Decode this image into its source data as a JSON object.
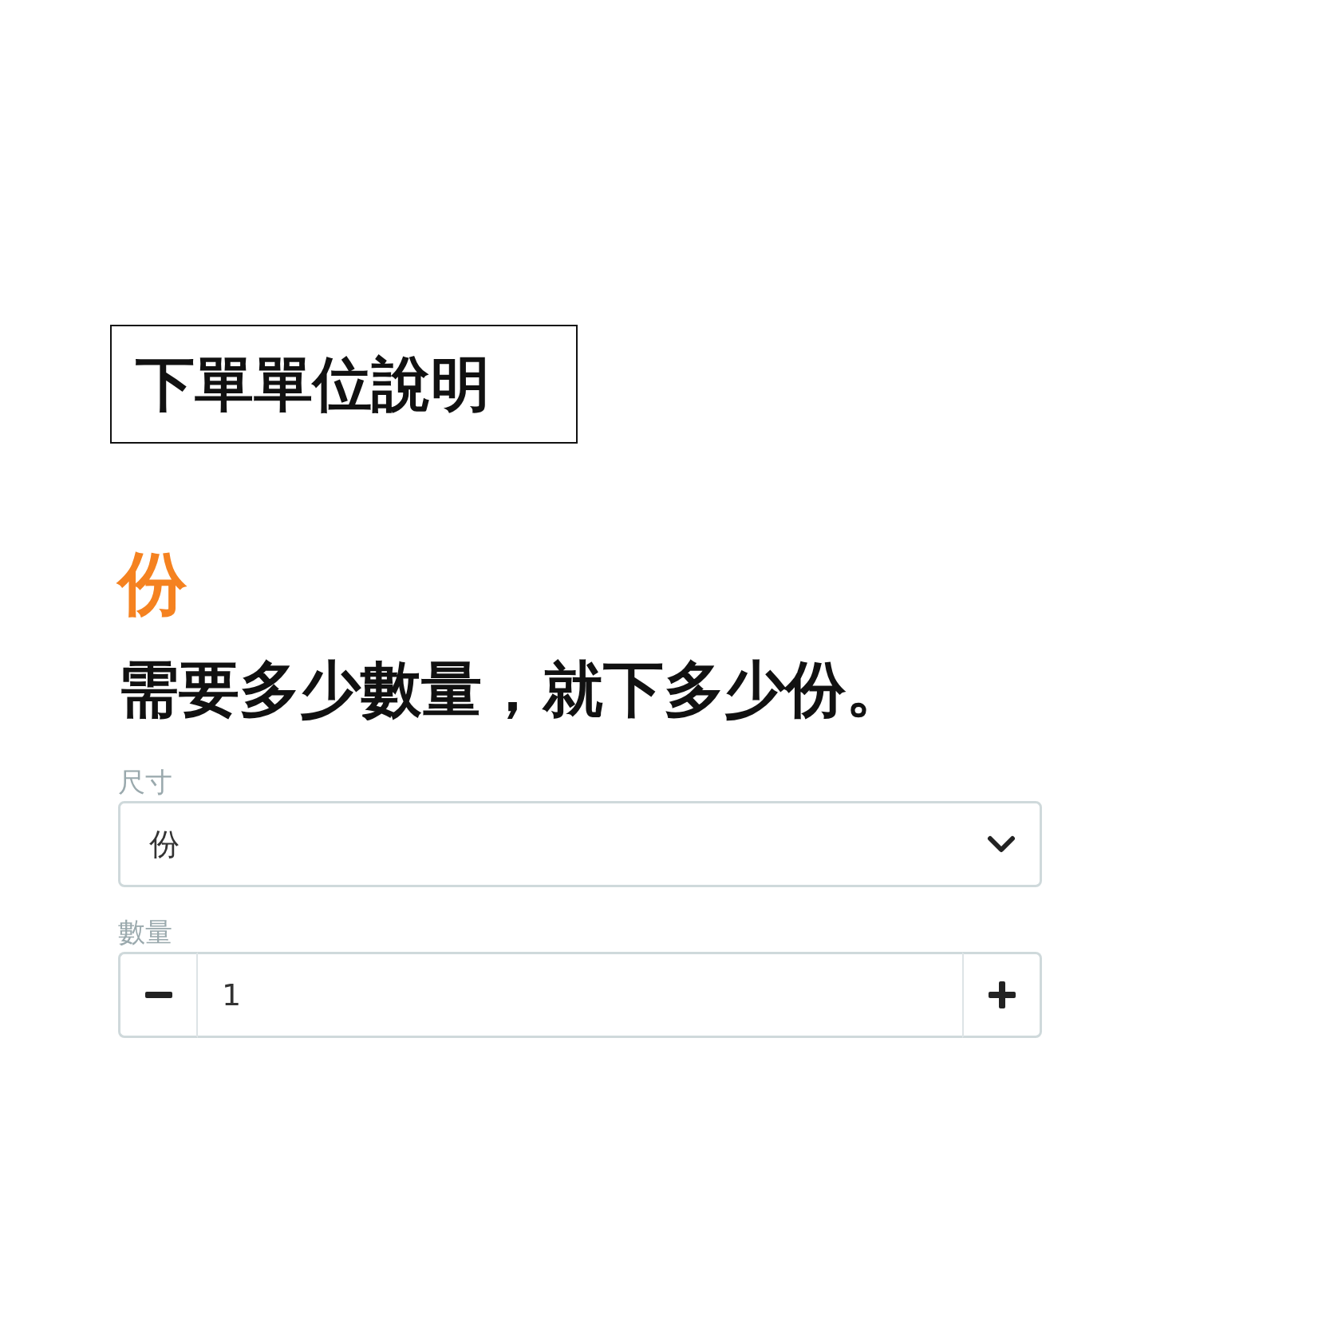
{
  "title": "下單單位說明",
  "unit": "份",
  "description": "需要多少數量，就下多少份。",
  "fields": [
    {
      "kind": "select",
      "label": "尺寸",
      "value": "份"
    },
    {
      "kind": "stepper",
      "label": "數量",
      "value": "1"
    }
  ]
}
